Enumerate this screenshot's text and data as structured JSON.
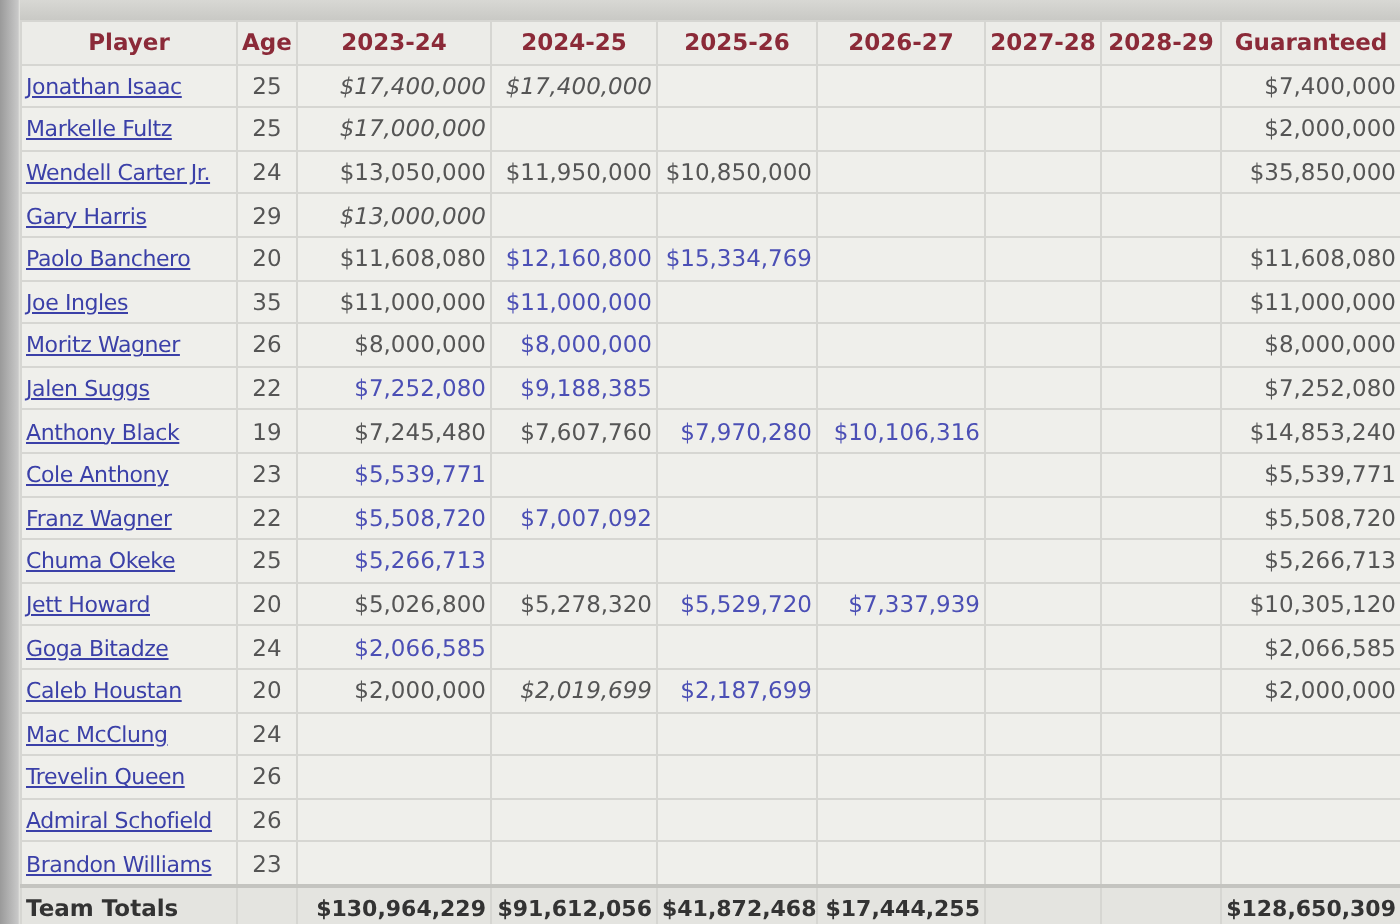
{
  "table": {
    "columns": [
      "Player",
      "Age",
      "2023-24",
      "2024-25",
      "2025-26",
      "2026-27",
      "2027-28",
      "2028-29",
      "Guaranteed"
    ],
    "rows": [
      {
        "cells": [
          "Jonathan Isaac",
          "25",
          {
            "text": "$17,400,000",
            "kind": "italic"
          },
          {
            "text": "$17,400,000",
            "kind": "italic"
          },
          "",
          "",
          "",
          "",
          {
            "text": "$7,400,000",
            "kind": "standard"
          }
        ]
      },
      {
        "cells": [
          "Markelle Fultz",
          "25",
          {
            "text": "$17,000,000",
            "kind": "italic"
          },
          "",
          "",
          "",
          "",
          "",
          {
            "text": "$2,000,000",
            "kind": "standard"
          }
        ]
      },
      {
        "cells": [
          "Wendell Carter Jr.",
          "24",
          {
            "text": "$13,050,000",
            "kind": "standard"
          },
          {
            "text": "$11,950,000",
            "kind": "standard"
          },
          {
            "text": "$10,850,000",
            "kind": "standard"
          },
          "",
          "",
          "",
          {
            "text": "$35,850,000",
            "kind": "standard"
          }
        ]
      },
      {
        "cells": [
          "Gary Harris",
          "29",
          {
            "text": "$13,000,000",
            "kind": "italic"
          },
          "",
          "",
          "",
          "",
          "",
          ""
        ]
      },
      {
        "cells": [
          "Paolo Banchero",
          "20",
          {
            "text": "$11,608,080",
            "kind": "standard"
          },
          {
            "text": "$12,160,800",
            "kind": "option"
          },
          {
            "text": "$15,334,769",
            "kind": "option"
          },
          "",
          "",
          "",
          {
            "text": "$11,608,080",
            "kind": "standard"
          }
        ]
      },
      {
        "cells": [
          "Joe Ingles",
          "35",
          {
            "text": "$11,000,000",
            "kind": "standard"
          },
          {
            "text": "$11,000,000",
            "kind": "option"
          },
          "",
          "",
          "",
          "",
          {
            "text": "$11,000,000",
            "kind": "standard"
          }
        ]
      },
      {
        "cells": [
          "Moritz Wagner",
          "26",
          {
            "text": "$8,000,000",
            "kind": "standard"
          },
          {
            "text": "$8,000,000",
            "kind": "option"
          },
          "",
          "",
          "",
          "",
          {
            "text": "$8,000,000",
            "kind": "standard"
          }
        ]
      },
      {
        "cells": [
          "Jalen Suggs",
          "22",
          {
            "text": "$7,252,080",
            "kind": "option"
          },
          {
            "text": "$9,188,385",
            "kind": "option"
          },
          "",
          "",
          "",
          "",
          {
            "text": "$7,252,080",
            "kind": "standard"
          }
        ]
      },
      {
        "cells": [
          "Anthony Black",
          "19",
          {
            "text": "$7,245,480",
            "kind": "standard"
          },
          {
            "text": "$7,607,760",
            "kind": "standard"
          },
          {
            "text": "$7,970,280",
            "kind": "option"
          },
          {
            "text": "$10,106,316",
            "kind": "option"
          },
          "",
          "",
          {
            "text": "$14,853,240",
            "kind": "standard"
          }
        ]
      },
      {
        "cells": [
          "Cole Anthony",
          "23",
          {
            "text": "$5,539,771",
            "kind": "option"
          },
          "",
          "",
          "",
          "",
          "",
          {
            "text": "$5,539,771",
            "kind": "standard"
          }
        ]
      },
      {
        "cells": [
          "Franz Wagner",
          "22",
          {
            "text": "$5,508,720",
            "kind": "option"
          },
          {
            "text": "$7,007,092",
            "kind": "option"
          },
          "",
          "",
          "",
          "",
          {
            "text": "$5,508,720",
            "kind": "standard"
          }
        ]
      },
      {
        "cells": [
          "Chuma Okeke",
          "25",
          {
            "text": "$5,266,713",
            "kind": "option"
          },
          "",
          "",
          "",
          "",
          "",
          {
            "text": "$5,266,713",
            "kind": "standard"
          }
        ]
      },
      {
        "cells": [
          "Jett Howard",
          "20",
          {
            "text": "$5,026,800",
            "kind": "standard"
          },
          {
            "text": "$5,278,320",
            "kind": "standard"
          },
          {
            "text": "$5,529,720",
            "kind": "option"
          },
          {
            "text": "$7,337,939",
            "kind": "option"
          },
          "",
          "",
          {
            "text": "$10,305,120",
            "kind": "standard"
          }
        ]
      },
      {
        "cells": [
          "Goga Bitadze",
          "24",
          {
            "text": "$2,066,585",
            "kind": "option"
          },
          "",
          "",
          "",
          "",
          "",
          {
            "text": "$2,066,585",
            "kind": "standard"
          }
        ]
      },
      {
        "cells": [
          "Caleb Houstan",
          "20",
          {
            "text": "$2,000,000",
            "kind": "standard"
          },
          {
            "text": "$2,019,699",
            "kind": "italic"
          },
          {
            "text": "$2,187,699",
            "kind": "option"
          },
          "",
          "",
          "",
          {
            "text": "$2,000,000",
            "kind": "standard"
          }
        ]
      },
      {
        "cells": [
          "Mac McClung",
          "24",
          "",
          "",
          "",
          "",
          "",
          "",
          ""
        ]
      },
      {
        "cells": [
          "Trevelin Queen",
          "26",
          "",
          "",
          "",
          "",
          "",
          "",
          ""
        ]
      },
      {
        "cells": [
          "Admiral Schofield",
          "26",
          "",
          "",
          "",
          "",
          "",
          "",
          ""
        ]
      },
      {
        "cells": [
          "Brandon Williams",
          "23",
          "",
          "",
          "",
          "",
          "",
          "",
          ""
        ]
      }
    ],
    "totals": {
      "cells": [
        "Team Totals",
        "",
        "$130,964,229",
        "$91,612,056",
        "$41,872,468",
        "$17,444,255",
        "",
        "",
        "$128,650,309"
      ]
    }
  }
}
